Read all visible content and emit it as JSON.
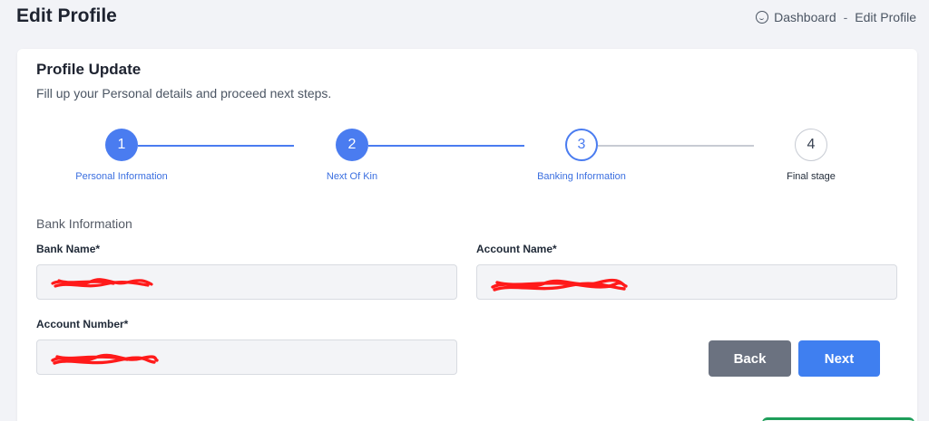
{
  "header": {
    "title": "Edit Profile",
    "breadcrumb": {
      "home": "Dashboard",
      "separator": "-",
      "current": "Edit Profile"
    }
  },
  "card": {
    "title": "Profile Update",
    "subtitle": "Fill up your Personal details and proceed next steps."
  },
  "steps": [
    {
      "number": "1",
      "label": "Personal Information",
      "state": "done"
    },
    {
      "number": "2",
      "label": "Next Of Kin",
      "state": "done"
    },
    {
      "number": "3",
      "label": "Banking Information",
      "state": "active"
    },
    {
      "number": "4",
      "label": "Final stage",
      "state": "todo"
    }
  ],
  "bank": {
    "section_title": "Bank Information",
    "bank_name_label": "Bank Name*",
    "account_name_label": "Account Name*",
    "account_number_label": "Account Number*"
  },
  "buttons": {
    "back": "Back",
    "next": "Next"
  },
  "colors": {
    "primary": "#4a7cf0",
    "back_button": "#6b7280",
    "redaction": "#ff0000",
    "pending_line": "#c7cbd3"
  },
  "icons": {
    "breadcrumb_home": "dashboard-icon"
  }
}
